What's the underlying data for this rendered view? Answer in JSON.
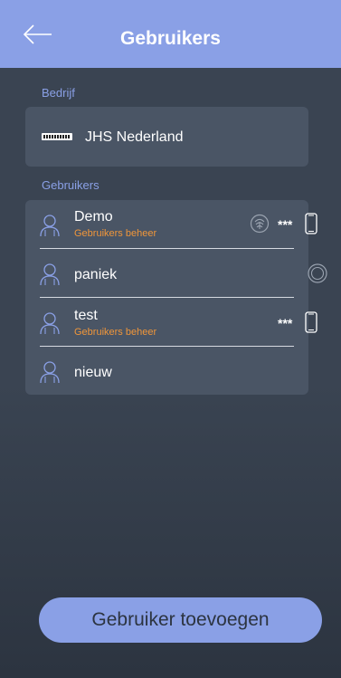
{
  "header": {
    "title": "Gebruikers",
    "back_icon": "arrow-left-icon",
    "color": "#8aa0e6"
  },
  "company": {
    "section_label": "Bedrijf",
    "name": "JHS Nederland",
    "logo_icon": "company-logo"
  },
  "users": {
    "section_label": "Gebruikers",
    "items": [
      {
        "name": "Demo",
        "role": "Gebruikers beheer",
        "dots": "***"
      },
      {
        "name": "paniek"
      },
      {
        "name": "test",
        "role": "Gebruikers beheer",
        "dots": "***"
      },
      {
        "name": "nieuw"
      }
    ]
  },
  "colors": {
    "accent": "#8aa0e6",
    "role": "#f0963a",
    "card": "#4a5565",
    "background": "#3a4452"
  },
  "actions": {
    "add_user_label": "Gebruiker toevoegen"
  }
}
